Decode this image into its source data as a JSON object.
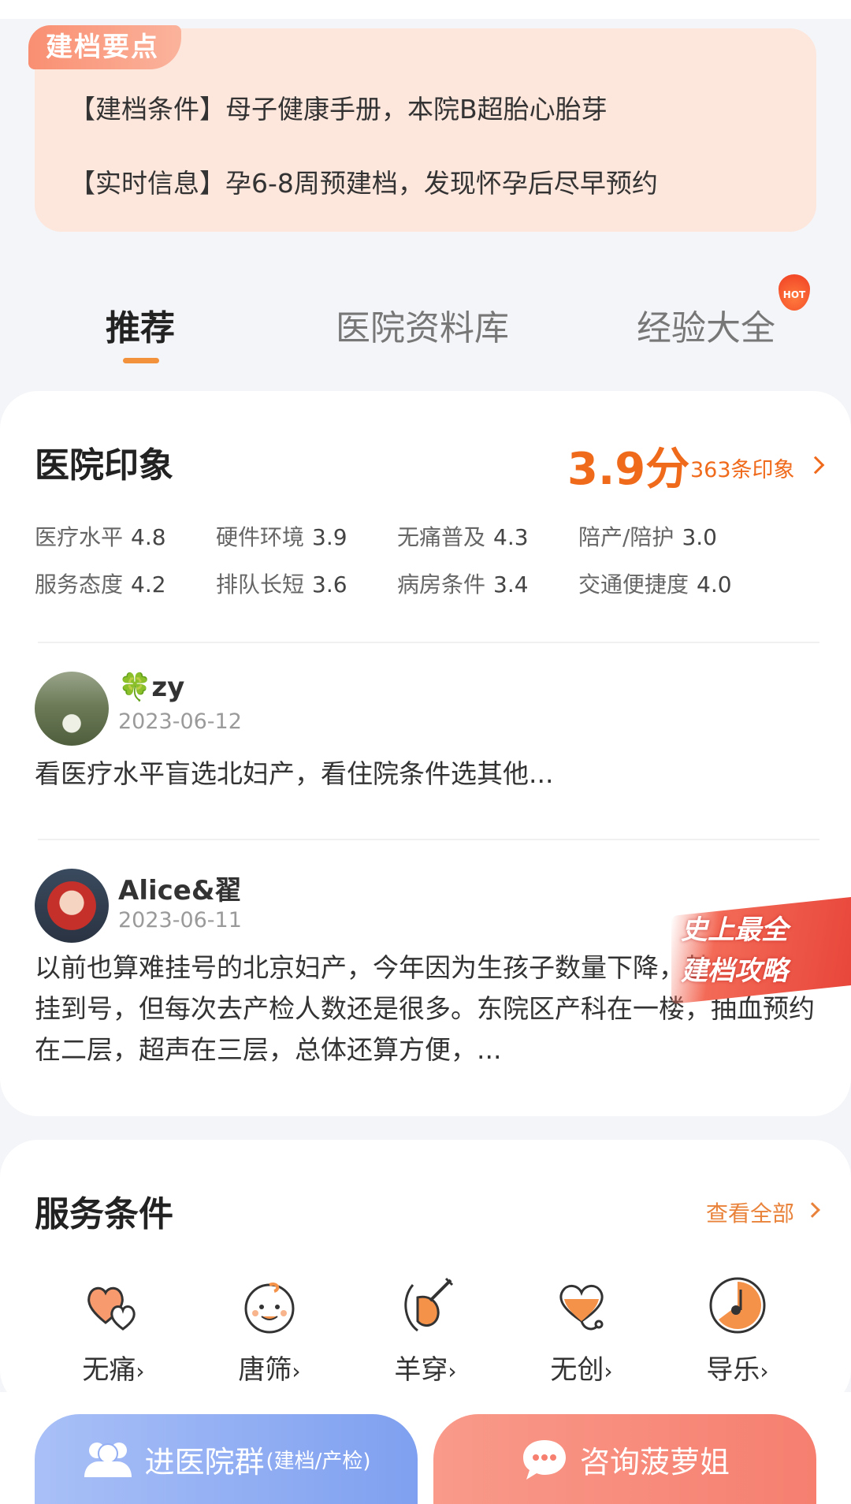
{
  "key_points": {
    "badge": "建档要点",
    "line1": "【建档条件】母子健康手册，本院B超胎心胎芽",
    "line2": "【实时信息】孕6-8周预建档，发现怀孕后尽早预约"
  },
  "tabs": [
    {
      "label": "推荐"
    },
    {
      "label": "医院资料库"
    },
    {
      "label": "经验大全",
      "badge": "HOT"
    }
  ],
  "impression": {
    "title": "医院印象",
    "score": "3.9分",
    "count_link": "363条印象",
    "ratings": [
      {
        "label": "医疗水平",
        "value": "4.8"
      },
      {
        "label": "硬件环境",
        "value": "3.9"
      },
      {
        "label": "无痛普及",
        "value": "4.3"
      },
      {
        "label": "陪产/陪护",
        "value": "3.0"
      },
      {
        "label": "服务态度",
        "value": "4.2"
      },
      {
        "label": "排队长短",
        "value": "3.6"
      },
      {
        "label": "病房条件",
        "value": "3.4"
      },
      {
        "label": "交通便捷度",
        "value": "4.0"
      }
    ],
    "reviews": [
      {
        "user": "🍀zy",
        "date": "2023-06-12",
        "text": "看医疗水平盲选北妇产，看住院条件选其他..."
      },
      {
        "user": "Alice&翟",
        "date": "2023-06-11",
        "text": "以前也算难挂号的北京妇产，今年因为生孩子数量下降，基本都可以挂到号，但每次去产检人数还是很多。东院区产科在一楼，抽血预约在二层，超声在三层，总体还算方便，..."
      }
    ]
  },
  "promo": {
    "line1": "史上最全",
    "line2": "建档攻略"
  },
  "services": {
    "title": "服务条件",
    "view_all": "查看全部",
    "items": [
      {
        "label": "无痛",
        "icon": "hearts-icon"
      },
      {
        "label": "唐筛",
        "icon": "baby-face-icon"
      },
      {
        "label": "羊穿",
        "icon": "amniocentesis-icon"
      },
      {
        "label": "无创",
        "icon": "heart-stethoscope-icon"
      },
      {
        "label": "导乐",
        "icon": "doula-icon"
      }
    ]
  },
  "bottom": {
    "group_button": "进医院群",
    "group_sub": "(建档/产检)",
    "consult_button": "咨询菠萝姐"
  },
  "colors": {
    "accent": "#f06a1c",
    "tab_underline": "#f3923c",
    "group_btn": "#7fa0f0",
    "consult_btn": "#f67f70"
  }
}
